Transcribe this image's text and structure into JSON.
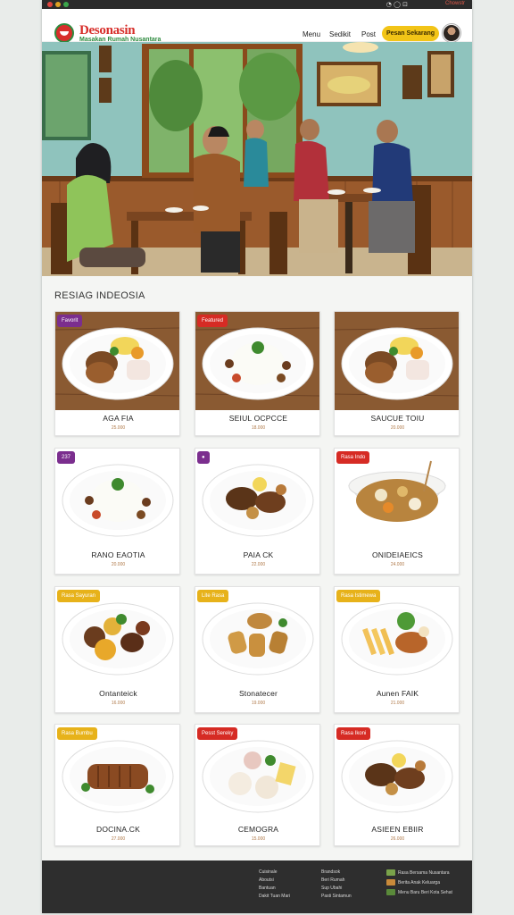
{
  "browser": {
    "toolbar_icons": "◔ ◯ ⊡",
    "toolbar_link": "Chowstr"
  },
  "header": {
    "brand": "Desonasin",
    "tagline": "Masakan Rumah Nusantara",
    "nav": [
      "Menu",
      "Sedikit",
      "Post"
    ],
    "cta": "Pesan Sekarang"
  },
  "section_title": "RESIAG INDEOSIA",
  "menu": [
    {
      "badge": "Favorit",
      "badge_color": "#7b2e8e",
      "name": "AGA FIA",
      "price": "25.000",
      "plate": "brown"
    },
    {
      "badge": "Featured",
      "badge_color": "#d62b24",
      "name": "SEIUL OCPCCE",
      "price": "18.000",
      "plate": "rice"
    },
    {
      "badge": "",
      "badge_color": "#d62b24",
      "name": "SAUCUE TOIU",
      "price": "20.000",
      "plate": "brown"
    },
    {
      "badge": "237",
      "badge_color": "#7b2e8e",
      "name": "RANO EAOTIA",
      "price": "20.000",
      "plate": "rice"
    },
    {
      "badge": "●",
      "badge_color": "#7b2e8e",
      "name": "PAIA CK",
      "price": "22.000",
      "plate": "meat"
    },
    {
      "badge": "Rasa Indo",
      "badge_color": "#d62b24",
      "name": "ONIDEIAEICS",
      "price": "24.000",
      "plate": "soup"
    },
    {
      "badge": "Rasa Sayuran",
      "badge_color": "#e7b21a",
      "name": "Ontanteick",
      "price": "16.000",
      "plate": "mix"
    },
    {
      "badge": "Lite Rasa",
      "badge_color": "#e7b21a",
      "name": "Stonatecer",
      "price": "19.000",
      "plate": "fried"
    },
    {
      "badge": "Rasa Istimewa",
      "badge_color": "#e7b21a",
      "name": "Aunen FAIK",
      "price": "21.000",
      "plate": "tofu"
    },
    {
      "badge": "Rasa Bumbu",
      "badge_color": "#e7b21a",
      "name": "DOCINA.CK",
      "price": "27.000",
      "plate": "steak"
    },
    {
      "badge": "Pesst Sereky",
      "badge_color": "#d62b24",
      "name": "CEMOGRA",
      "price": "15.000",
      "plate": "dumpling"
    },
    {
      "badge": "Rasa Ikoni",
      "badge_color": "#d62b24",
      "name": "ASIEEN EBIIR",
      "price": "26.000",
      "plate": "meat"
    }
  ],
  "footer": {
    "col1": [
      "Cuisinale",
      "Aboutsi",
      "Bantuan",
      "Dakit Tuan Mari"
    ],
    "col2": [
      "Brandsok",
      "Beri Rumah",
      "Sup Ubahi",
      "Pasti Sintamun"
    ],
    "col3": [
      "Rasa Bersama Nusantara",
      "Berita Anak Keluarga",
      "Menu Baru Beri Kota Sehat"
    ]
  },
  "colors": {
    "brand_red": "#d72e2a",
    "brand_green": "#2e8b3f",
    "cta_yellow": "#f2c417",
    "footer_bg": "#2e2e2e"
  }
}
